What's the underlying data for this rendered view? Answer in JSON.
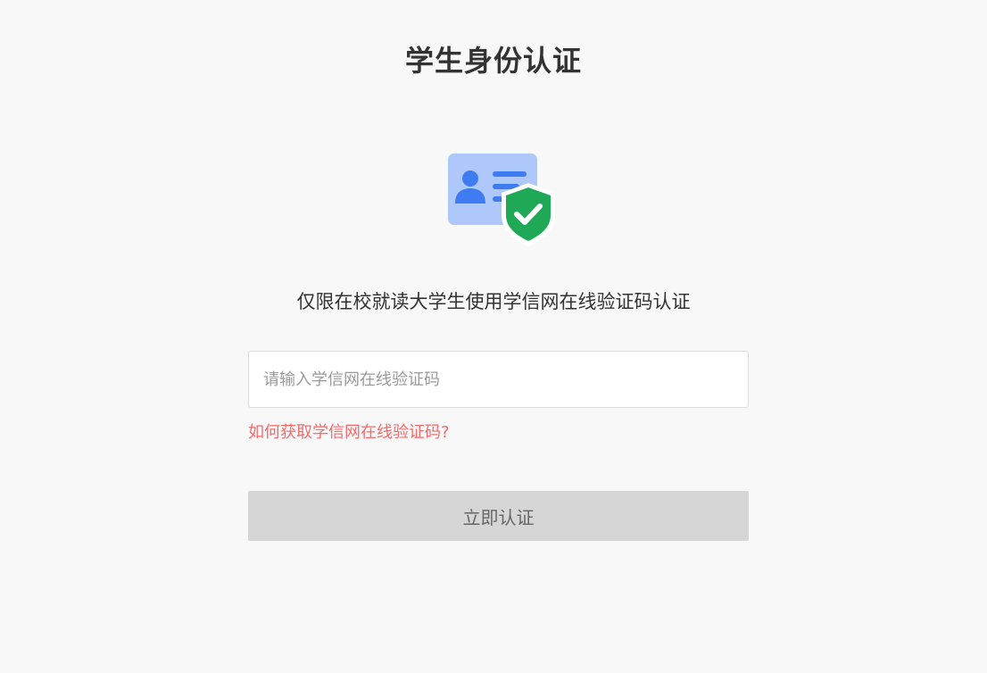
{
  "page": {
    "title": "学生身份认证",
    "subtitle": "仅限在校就读大学生使用学信网在线验证码认证"
  },
  "form": {
    "code_input": {
      "placeholder": "请输入学信网在线验证码",
      "value": ""
    },
    "help_link_label": "如何获取学信网在线验证码?",
    "submit_label": "立即认证",
    "submit_enabled": false
  },
  "illustration": {
    "icon": "id-card-verified-icon",
    "card_color": "#aec8fb",
    "person_color": "#3f7cf2",
    "shield_color": "#1fa855",
    "check_color": "#ffffff"
  },
  "colors": {
    "background": "#f8f8f8",
    "title": "#333333",
    "link": "#f46a6a",
    "button_disabled_bg": "#d6d6d6",
    "button_disabled_text": "#666666"
  }
}
